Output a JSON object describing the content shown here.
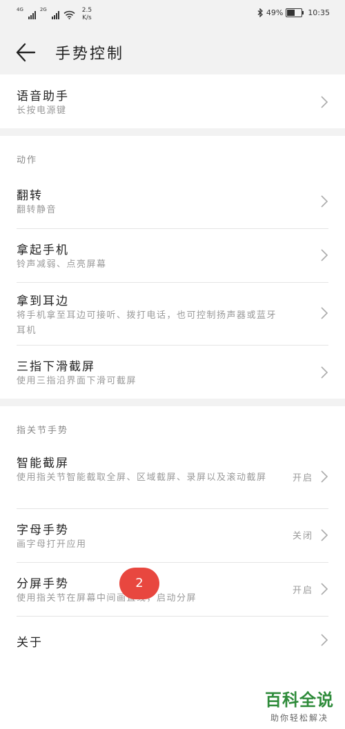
{
  "status": {
    "net1": "4G",
    "net2": "2G",
    "speed_value": "2.5",
    "speed_unit": "K/s",
    "battery": "49%",
    "battery_level": 0.49,
    "time": "10:35"
  },
  "header": {
    "title": "手势控制"
  },
  "voice": {
    "title": "语音助手",
    "subtitle": "长按电源键"
  },
  "actions": {
    "section": "动作",
    "items": [
      {
        "title": "翻转",
        "subtitle": "翻转静音"
      },
      {
        "title": "拿起手机",
        "subtitle": "铃声减弱、点亮屏幕"
      },
      {
        "title": "拿到耳边",
        "subtitle": "将手机拿至耳边可接听、拨打电话，也可控制扬声器或蓝牙耳机"
      },
      {
        "title": "三指下滑截屏",
        "subtitle": "使用三指沿界面下滑可截屏"
      }
    ]
  },
  "knuckle": {
    "section": "指关节手势",
    "items": [
      {
        "title": "智能截屏",
        "subtitle": "使用指关节智能截取全屏、区域截屏、录屏以及滚动截屏",
        "value": "开启"
      },
      {
        "title": "字母手势",
        "subtitle": "画字母打开应用",
        "value": "关闭"
      },
      {
        "title": "分屏手势",
        "subtitle": "使用指关节在屏幕中间画直线，启动分屏",
        "value": "开启"
      }
    ]
  },
  "about": {
    "title": "关于"
  },
  "marker": "2",
  "watermark": {
    "main": "百科全说",
    "sub": "助你轻松解决"
  }
}
